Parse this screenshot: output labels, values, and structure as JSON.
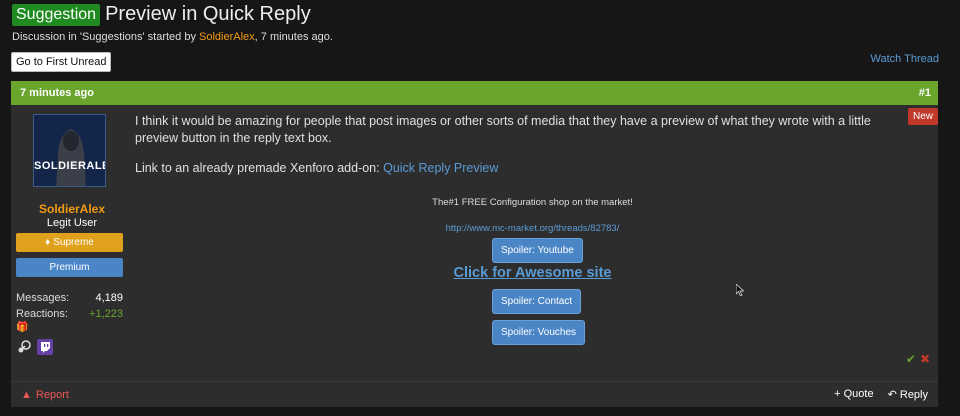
{
  "thread": {
    "prefix": "Suggestion",
    "title": "Preview in Quick Reply",
    "meta_prefix": "Discussion in 'Suggestions' started by ",
    "author": "SoldierAlex",
    "meta_suffix": ", 7 minutes ago."
  },
  "controls": {
    "first_unread": "Go to First Unread",
    "watch": "Watch Thread"
  },
  "post": {
    "time": "7 minutes ago",
    "number": "#1",
    "new_label": "New",
    "body_1": "I think it would be amazing for people that post images or other sorts of media that they have a preview of what they wrote with a little preview button in the reply text box.",
    "body_2_prefix": "Link to an already premade Xenforo add-on: ",
    "body_2_link": "Quick Reply Preview"
  },
  "user": {
    "avatar_text": "SOLDIERALEX",
    "name": "SoldierAlex",
    "title": "Legit User",
    "badge_supreme": "Supreme",
    "badge_premium": "Premium",
    "messages_label": "Messages:",
    "messages_value": "4,189",
    "reactions_label": "Reactions:",
    "reactions_value": "+1,223"
  },
  "signature": {
    "line": "The#1 FREE Configuration shop on the market!",
    "link": "http://www.mc-market.org/threads/82783/",
    "spoiler_1": "Spoiler: Youtube",
    "awesome": "Click for Awesome site",
    "spoiler_2": "Spoiler: Contact",
    "spoiler_3": "Spoiler: Vouches"
  },
  "footer": {
    "report": "Report",
    "quote": "+ Quote",
    "reply": "Reply"
  },
  "colors": {
    "accent_green": "#6aa62c",
    "link_blue": "#5b9bd5",
    "author_orange": "#f39c12"
  }
}
